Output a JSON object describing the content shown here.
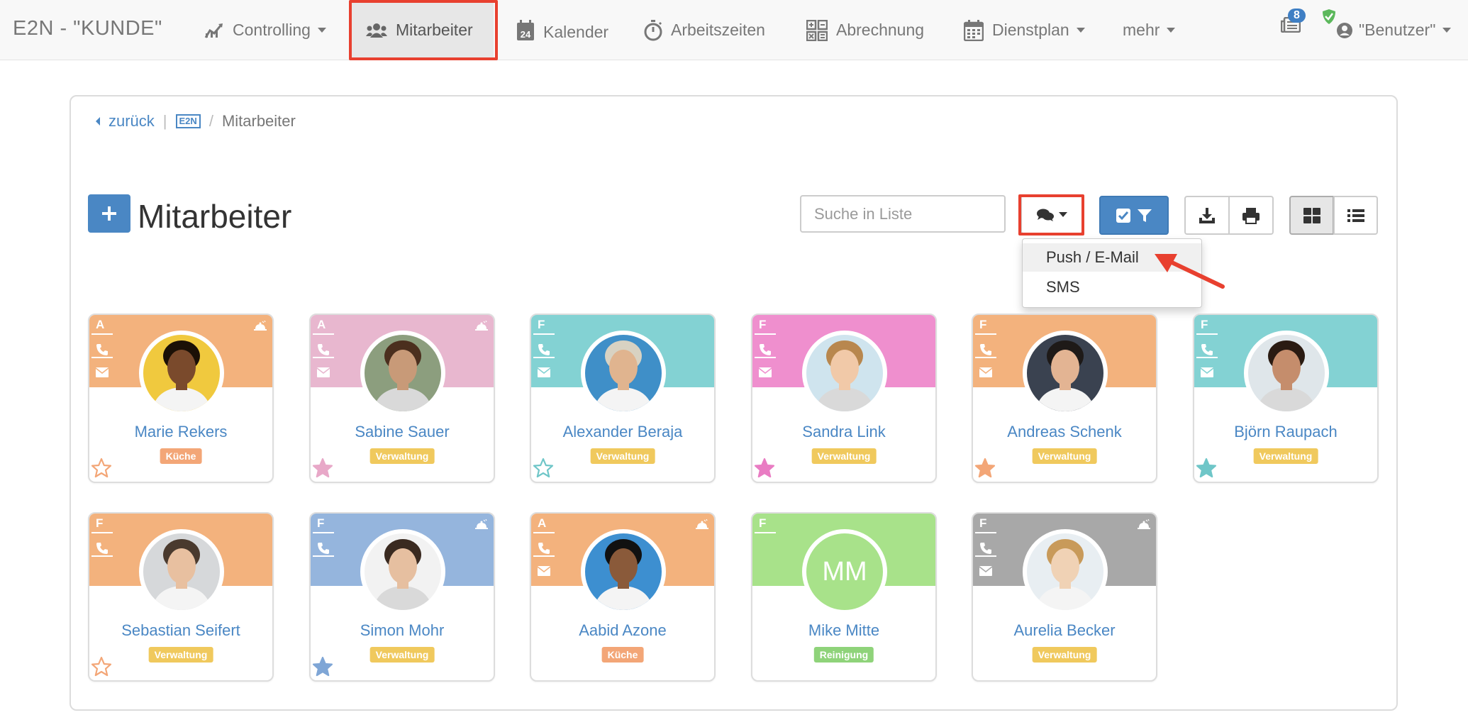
{
  "app": {
    "brand": "E2N - \"KUNDE\""
  },
  "nav": {
    "items": [
      {
        "label": "Controlling",
        "icon": "chart-line-icon",
        "caret": true
      },
      {
        "label": "Mitarbeiter",
        "icon": "users-icon",
        "active": true
      },
      {
        "label": "Kalender",
        "icon": "calendar-24-icon"
      },
      {
        "label": "Arbeitszeiten",
        "icon": "stopwatch-icon"
      },
      {
        "label": "Abrechnung",
        "icon": "calculator-icon"
      },
      {
        "label": "Dienstplan",
        "icon": "calendar-grid-icon",
        "caret": true
      },
      {
        "label": "mehr",
        "caret": true
      }
    ],
    "notifications_count": "8",
    "user_label": "\"Benutzer\""
  },
  "breadcrumb": {
    "back": "zurück",
    "logo_text": "E2N",
    "current": "Mitarbeiter"
  },
  "page": {
    "title": "Mitarbeiter"
  },
  "search": {
    "placeholder": "Suche in Liste"
  },
  "message_menu": {
    "items": [
      {
        "label": "Push / E-Mail",
        "hover": true
      },
      {
        "label": "SMS"
      }
    ]
  },
  "colors": {
    "primary": "#4a87c4",
    "orange": "#f3b27d",
    "pink": "#e8b7cf",
    "teal": "#83d2d3",
    "magenta": "#ef8fce",
    "blue": "#95b5dd",
    "green": "#a8e28a",
    "grey": "#a8a8a8",
    "highlight": "#e8402f"
  },
  "employees": [
    {
      "name": "Marie Rekers",
      "letter": "A",
      "dept": "Küche",
      "dept_color": "#f3a677",
      "band": "#f3b27d",
      "star": "outline",
      "star_color": "#f3a677",
      "phone": true,
      "mail": true,
      "meal": true
    },
    {
      "name": "Sabine Sauer",
      "letter": "A",
      "dept": "Verwaltung",
      "dept_color": "#f0c95d",
      "band": "#e8b7cf",
      "star": "filled",
      "star_color": "#e8a8c8",
      "phone": true,
      "mail": true,
      "meal": true
    },
    {
      "name": "Alexander Beraja",
      "letter": "F",
      "dept": "Verwaltung",
      "dept_color": "#f0c95d",
      "band": "#83d2d3",
      "star": "outline",
      "star_color": "#6fc6c8",
      "phone": true,
      "mail": true,
      "meal": false
    },
    {
      "name": "Sandra Link",
      "letter": "F",
      "dept": "Verwaltung",
      "dept_color": "#f0c95d",
      "band": "#ef8fce",
      "star": "filled",
      "star_color": "#e97cc3",
      "phone": true,
      "mail": true,
      "meal": false
    },
    {
      "name": "Andreas Schenk",
      "letter": "F",
      "dept": "Verwaltung",
      "dept_color": "#f0c95d",
      "band": "#f3b27d",
      "star": "filled",
      "star_color": "#f3a677",
      "phone": true,
      "mail": true,
      "meal": false
    },
    {
      "name": "Björn Raupach",
      "letter": "F",
      "dept": "Verwaltung",
      "dept_color": "#f0c95d",
      "band": "#83d2d3",
      "star": "filled",
      "star_color": "#6fc6c8",
      "phone": true,
      "mail": true,
      "meal": false
    },
    {
      "name": "Sebastian Seifert",
      "letter": "F",
      "dept": "Verwaltung",
      "dept_color": "#f0c95d",
      "band": "#f3b27d",
      "star": "outline",
      "star_color": "#f3a677",
      "phone": true,
      "mail": false,
      "meal": false
    },
    {
      "name": "Simon Mohr",
      "letter": "F",
      "dept": "Verwaltung",
      "dept_color": "#f0c95d",
      "band": "#95b5dd",
      "star": "filled",
      "star_color": "#7fa6d6",
      "phone": true,
      "mail": false,
      "meal": true
    },
    {
      "name": "Aabid Azone",
      "letter": "A",
      "dept": "Küche",
      "dept_color": "#f3a677",
      "band": "#f3b27d",
      "star": "none",
      "star_color": "",
      "phone": true,
      "mail": true,
      "meal": true
    },
    {
      "name": "Mike Mitte",
      "letter": "F",
      "dept": "Reinigung",
      "dept_color": "#8fd37a",
      "band": "#a8e28a",
      "star": "none",
      "star_color": "",
      "phone": false,
      "mail": false,
      "meal": false,
      "initials": "MM"
    },
    {
      "name": "Aurelia Becker",
      "letter": "F",
      "dept": "Verwaltung",
      "dept_color": "#f0c95d",
      "band": "#a8a8a8",
      "star": "none",
      "star_color": "",
      "phone": true,
      "mail": true,
      "meal": true
    }
  ]
}
